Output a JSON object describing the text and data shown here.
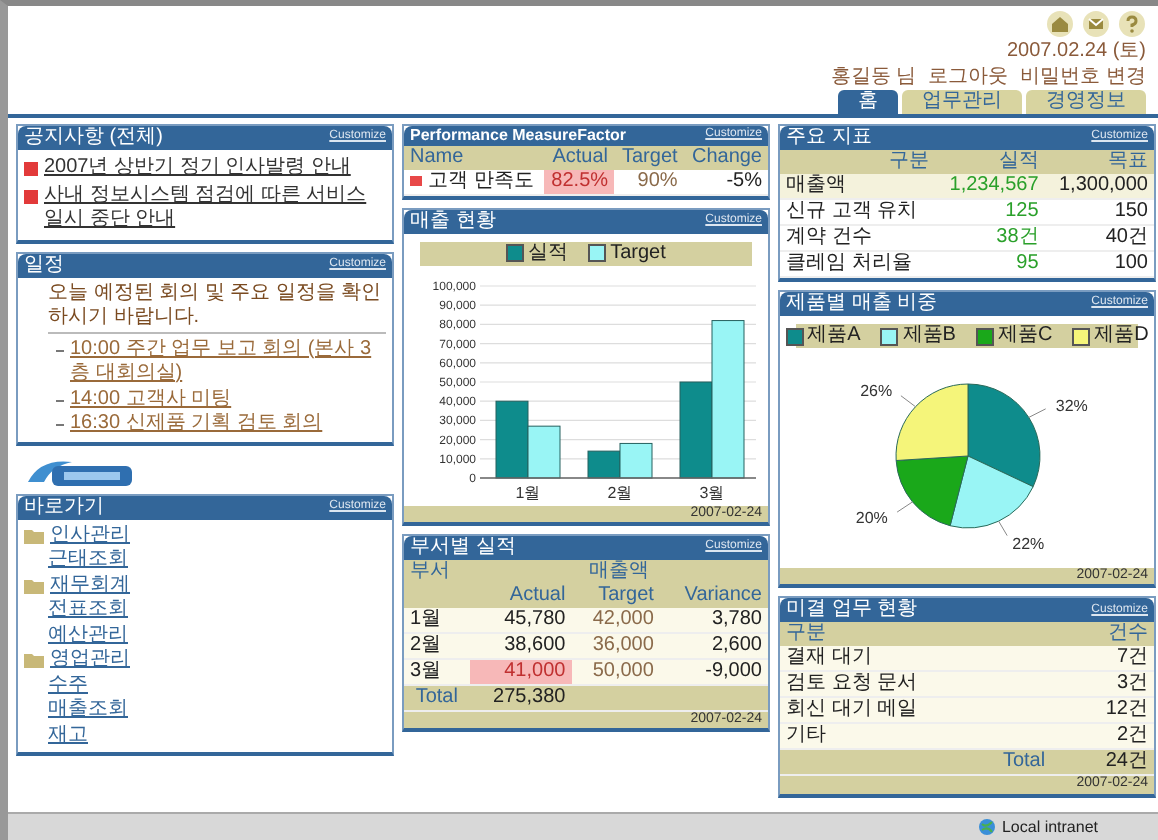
{
  "header": {
    "date": "2007.02.24 (토)",
    "user_links": [
      {
        "label": "홍길동 님"
      },
      {
        "label": "로그아웃"
      },
      {
        "label": "비밀번호 변경"
      }
    ]
  },
  "tabs": [
    {
      "label": "홈",
      "selected": true
    },
    {
      "label": "업무관리",
      "selected": false
    },
    {
      "label": "경영정보",
      "selected": false
    }
  ],
  "notices": {
    "title": "공지사항 (전체)",
    "action": "Customize",
    "items": [
      {
        "text": "2007년 상반기 정기 인사발령 안내"
      },
      {
        "text": "사내 정보시스템 점검에 따른 서비스 일시 중단 안내"
      }
    ]
  },
  "schedule": {
    "title": "일정",
    "action": "Customize",
    "intro": "오늘 예정된 회의 및 주요 일정을 확인하시기 바랍니다.",
    "items": [
      {
        "text": "10:00 주간 업무 보고 회의 (본사 3층 대회의실)"
      },
      {
        "text": "14:00 고객사 미팅"
      },
      {
        "text": "16:30 신제품 기획 검토 회의"
      }
    ]
  },
  "links": {
    "title": "바로가기",
    "action": "Customize",
    "groups": [
      {
        "label": "인사관리",
        "children": [
          {
            "label": "근태조회"
          }
        ]
      },
      {
        "label": "재무회계",
        "children": [
          {
            "label": "전표조회"
          },
          {
            "label": "예산관리"
          }
        ]
      },
      {
        "label": "영업관리",
        "children": [
          {
            "label": "수주"
          },
          {
            "label": "매출조회"
          },
          {
            "label": "재고"
          }
        ]
      }
    ]
  },
  "measures": {
    "title": "Performance MeasureFactor",
    "action": "Customize",
    "columns": [
      "Name",
      "Actual",
      "Target",
      "Change"
    ],
    "rows": [
      {
        "name": "고객 만족도",
        "actual": "82.5%",
        "target": "90%",
        "change": "-5%",
        "below_target": true
      }
    ]
  },
  "sales": {
    "title": "매출 현황",
    "action": "Customize",
    "footer": "2007-02-24",
    "chart_data": {
      "type": "bar",
      "categories": [
        "1월",
        "2월",
        "3월"
      ],
      "series": [
        {
          "name": "실적",
          "color": "#0e8c8c",
          "values": [
            40000,
            14000,
            50000
          ]
        },
        {
          "name": "Target",
          "color": "#99f5f5",
          "values": [
            27000,
            18000,
            82000
          ]
        }
      ],
      "grid": true,
      "ylim": [
        0,
        100000
      ],
      "yticks": [
        {
          "value": 0,
          "label": "0"
        },
        {
          "value": 10000,
          "label": "10,000"
        },
        {
          "value": 20000,
          "label": "20,000"
        },
        {
          "value": 30000,
          "label": "30,000"
        },
        {
          "value": 40000,
          "label": "40,000"
        },
        {
          "value": 50000,
          "label": "50,000"
        },
        {
          "value": 60000,
          "label": "60,000"
        },
        {
          "value": 70000,
          "label": "70,000"
        },
        {
          "value": 80000,
          "label": "80,000"
        },
        {
          "value": 90000,
          "label": "90,000"
        },
        {
          "value": 100000,
          "label": "100,000"
        }
      ]
    }
  },
  "dept": {
    "title": "부서별 실적",
    "action": "Customize",
    "group_header": [
      "부서",
      "매출액"
    ],
    "columns": [
      "Actual",
      "Target",
      "Variance"
    ],
    "rows": [
      {
        "label": "1월",
        "actual": "45,780",
        "target": "42,000",
        "variance": "3,780",
        "below_target": false
      },
      {
        "label": "2월",
        "actual": "38,600",
        "target": "36,000",
        "variance": "2,600",
        "below_target": false
      },
      {
        "label": "3월",
        "actual": "41,000",
        "target": "50,000",
        "variance": "-9,000",
        "below_target": true
      }
    ],
    "total_label": "Total",
    "total": "275,380",
    "footer": "2007-02-24"
  },
  "kpi": {
    "title": "주요 지표",
    "action": "Customize",
    "columns": [
      "구분",
      "실적",
      "목표"
    ],
    "rows": [
      {
        "name": "매출액",
        "actual": "1,234,567",
        "target": "1,300,000",
        "selected": true
      },
      {
        "name": "신규 고객 유치",
        "actual": "125",
        "target": "150",
        "selected": false
      },
      {
        "name": "계약 건수",
        "actual": "38건",
        "target": "40건",
        "selected": false
      },
      {
        "name": "클레임 처리율",
        "actual": "95",
        "target": "100",
        "selected": false
      }
    ]
  },
  "products": {
    "title": "제품별 매출 비중",
    "action": "Customize",
    "footer": "2007-02-24",
    "chart_data": {
      "type": "pie",
      "categories": [
        "제품A",
        "제품B",
        "제품C",
        "제품D"
      ],
      "values": [
        32,
        22,
        20,
        26
      ],
      "colors": [
        "#0e8c8c",
        "#99f5f5",
        "#1aa81a",
        "#f5f57a"
      ],
      "value_labels": [
        "32%",
        "22%",
        "20%",
        "26%"
      ]
    }
  },
  "pending": {
    "title": "미결 업무 현황",
    "action": "Customize",
    "columns": [
      "구분",
      "건수"
    ],
    "rows": [
      {
        "name": "결재 대기",
        "value": "7건"
      },
      {
        "name": "검토 요청 문서",
        "value": "3건"
      },
      {
        "name": "회신 대기 메일",
        "value": "12건"
      },
      {
        "name": "기타",
        "value": "2건"
      }
    ],
    "total_label": "Total",
    "total": "24건",
    "footer": "2007-02-24"
  },
  "status_bar": {
    "zone": "Local intranet"
  }
}
